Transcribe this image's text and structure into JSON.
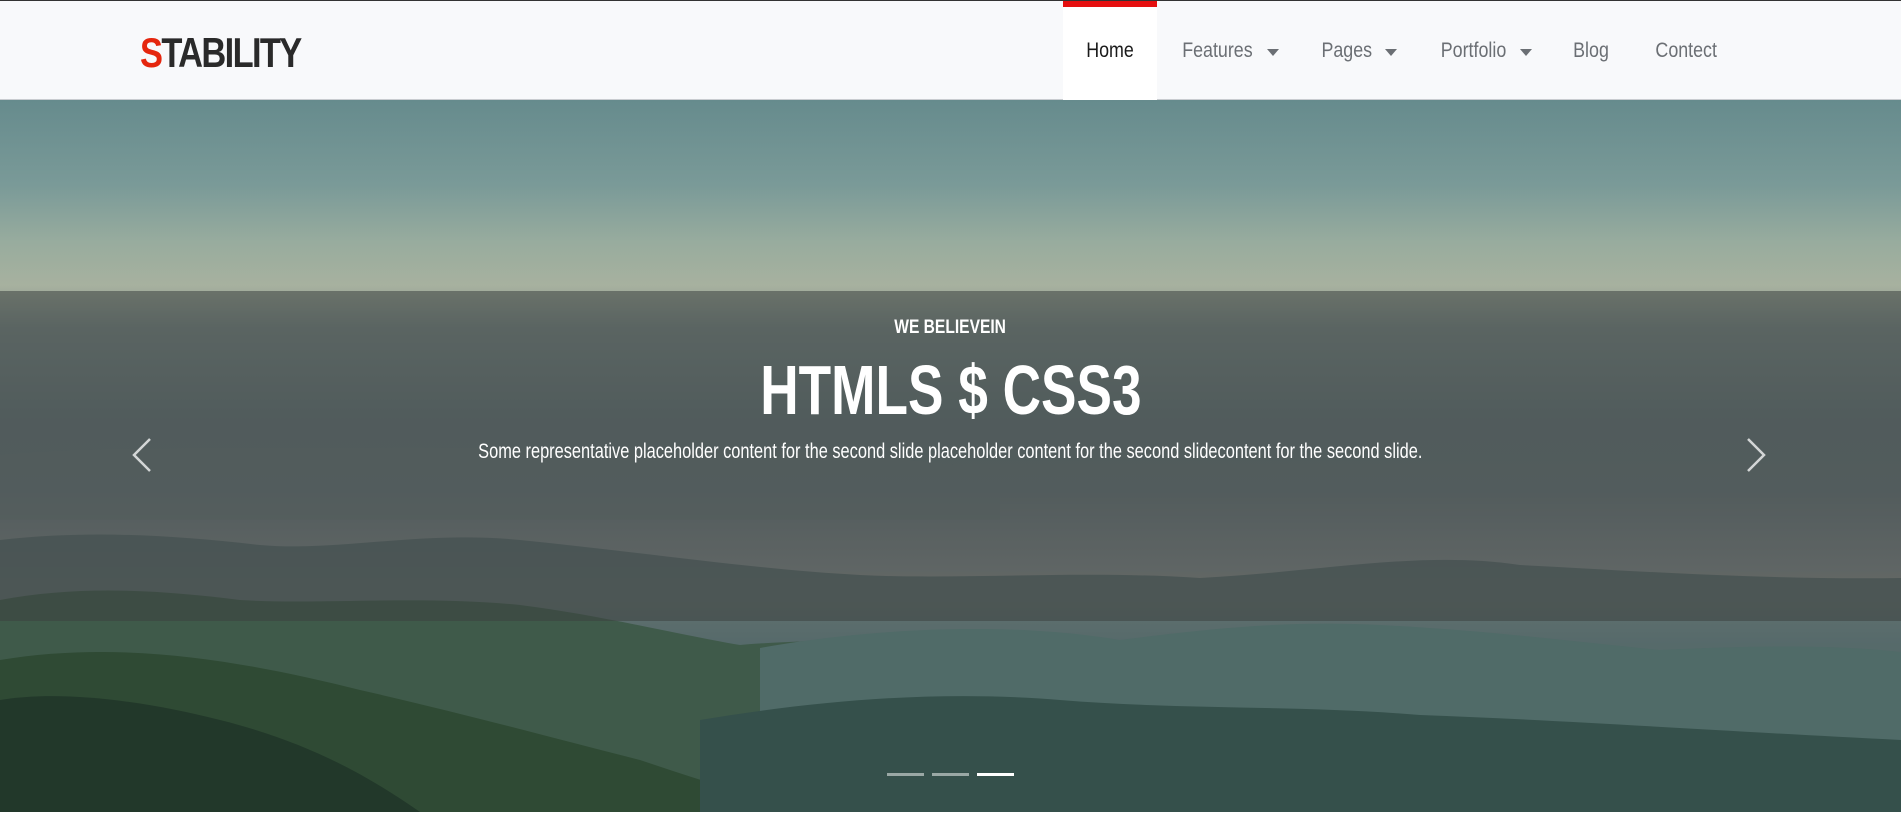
{
  "brand": {
    "first_letter": "S",
    "rest": "TABILITY",
    "accent_color": "#e5260e"
  },
  "nav": {
    "items": [
      {
        "label": "Home",
        "active": true,
        "dropdown": false
      },
      {
        "label": "Features",
        "active": false,
        "dropdown": true
      },
      {
        "label": "Pages",
        "active": false,
        "dropdown": true
      },
      {
        "label": "Portfolio",
        "active": false,
        "dropdown": true
      },
      {
        "label": "Blog",
        "active": false,
        "dropdown": false
      },
      {
        "label": "Contect",
        "active": false,
        "dropdown": false
      }
    ],
    "active_indicator_color": "#e50f0f"
  },
  "hero": {
    "eyebrow": "WE BELIEVEIN",
    "headline": "HTMLS $ CSS3",
    "caption": "Some representative placeholder content for the second slide placeholder content for the second slidecontent for the second slide.",
    "prev_icon": "chevron-left-icon",
    "next_icon": "chevron-right-icon",
    "slide_count": 3,
    "active_slide": 3
  }
}
